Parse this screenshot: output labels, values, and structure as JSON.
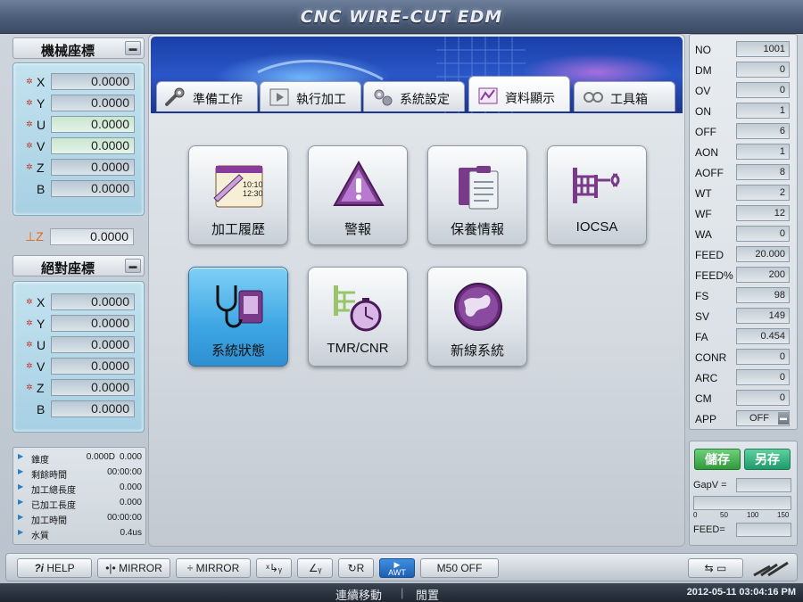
{
  "title": "CNC WIRE-CUT EDM",
  "machine_coords": {
    "label": "機械座標",
    "rows": [
      {
        "axis": "X",
        "value": "0.0000",
        "star": true
      },
      {
        "axis": "Y",
        "value": "0.0000",
        "star": true
      },
      {
        "axis": "U",
        "value": "0.0000",
        "star": true
      },
      {
        "axis": "V",
        "value": "0.0000",
        "star": true
      },
      {
        "axis": "Z",
        "value": "0.0000",
        "star": true
      },
      {
        "axis": "B",
        "value": "0.0000",
        "star": false
      }
    ]
  },
  "z_limit": {
    "axis": "⊥Z",
    "value": "0.0000"
  },
  "absolute_coords": {
    "label": "絕對座標",
    "rows": [
      {
        "axis": "X",
        "value": "0.0000",
        "star": true
      },
      {
        "axis": "Y",
        "value": "0.0000",
        "star": true
      },
      {
        "axis": "U",
        "value": "0.0000",
        "star": true
      },
      {
        "axis": "V",
        "value": "0.0000",
        "star": true
      },
      {
        "axis": "Z",
        "value": "0.0000",
        "star": true
      },
      {
        "axis": "B",
        "value": "0.0000",
        "star": false
      }
    ]
  },
  "info": [
    {
      "key": "錐度",
      "v1": "0.000D",
      "v2": "0.000"
    },
    {
      "key": "剩餘時間",
      "v1": "",
      "v2": "00:00:00"
    },
    {
      "key": "加工總長度",
      "v1": "",
      "v2": "0.000"
    },
    {
      "key": "已加工長度",
      "v1": "",
      "v2": "0.000"
    },
    {
      "key": "加工時間",
      "v1": "",
      "v2": "00:00:00"
    },
    {
      "key": "水質",
      "v1": "",
      "v2": "0.4us"
    }
  ],
  "tabs": [
    {
      "label": "準備工作",
      "icon": "wrench-icon"
    },
    {
      "label": "執行加工",
      "icon": "play-icon"
    },
    {
      "label": "系統設定",
      "icon": "gears-icon"
    },
    {
      "label": "資料顯示",
      "icon": "chart-icon",
      "active": true
    },
    {
      "label": "工具箱",
      "icon": "toolbox-icon"
    }
  ],
  "icon_buttons": [
    {
      "label": "加工履歷",
      "icon": "history-icon",
      "clock": "10:10\n12:30"
    },
    {
      "label": "警報",
      "icon": "warning-icon"
    },
    {
      "label": "保養情報",
      "icon": "clipboard-icon"
    },
    {
      "label": "IOCSA",
      "icon": "circuit-icon"
    },
    {
      "label": "系統狀態",
      "icon": "stethoscope-icon",
      "selected": true
    },
    {
      "label": "TMR/CNR",
      "icon": "timer-icon"
    },
    {
      "label": "新線系統",
      "icon": "globe-icon"
    }
  ],
  "history_clock": {
    "top": "10:10",
    "bottom": "12:30"
  },
  "params": [
    {
      "key": "NO",
      "value": "1001"
    },
    {
      "key": "DM",
      "value": "0"
    },
    {
      "key": "OV",
      "value": "0"
    },
    {
      "key": "ON",
      "value": "1"
    },
    {
      "key": "OFF",
      "value": "6"
    },
    {
      "key": "AON",
      "value": "1"
    },
    {
      "key": "AOFF",
      "value": "8"
    },
    {
      "key": "WT",
      "value": "2"
    },
    {
      "key": "WF",
      "value": "12"
    },
    {
      "key": "WA",
      "value": "0"
    },
    {
      "key": "FEED",
      "value": "20.000"
    },
    {
      "key": "FEED%",
      "value": "200"
    },
    {
      "key": "FS",
      "value": "98"
    },
    {
      "key": "SV",
      "value": "149"
    },
    {
      "key": "FA",
      "value": "0.454"
    },
    {
      "key": "CONR",
      "value": "0"
    },
    {
      "key": "ARC",
      "value": "0"
    },
    {
      "key": "CM",
      "value": "0"
    },
    {
      "key": "APP",
      "value": "OFF"
    }
  ],
  "save_label": "儲存",
  "save_as_label": "另存",
  "gapv_label": "GapV =",
  "gapv_value": "",
  "gap_scale": [
    "0",
    "50",
    "100",
    "150"
  ],
  "feed_label": "FEED=",
  "feed_value": "",
  "toolbar": {
    "help": "HELP",
    "mirror1": "MIRROR",
    "mirror2": "MIRROR",
    "awt": "AWT",
    "m50": "M50 OFF"
  },
  "status": {
    "mode": "連續移動",
    "state": "閒置",
    "datetime": "2012-05-11 03:04:16 PM"
  },
  "colors": {
    "accent": "#3ea6e4",
    "green": "#2f9a3c",
    "star": "#c0392b",
    "z_orange": "#e06a10"
  }
}
